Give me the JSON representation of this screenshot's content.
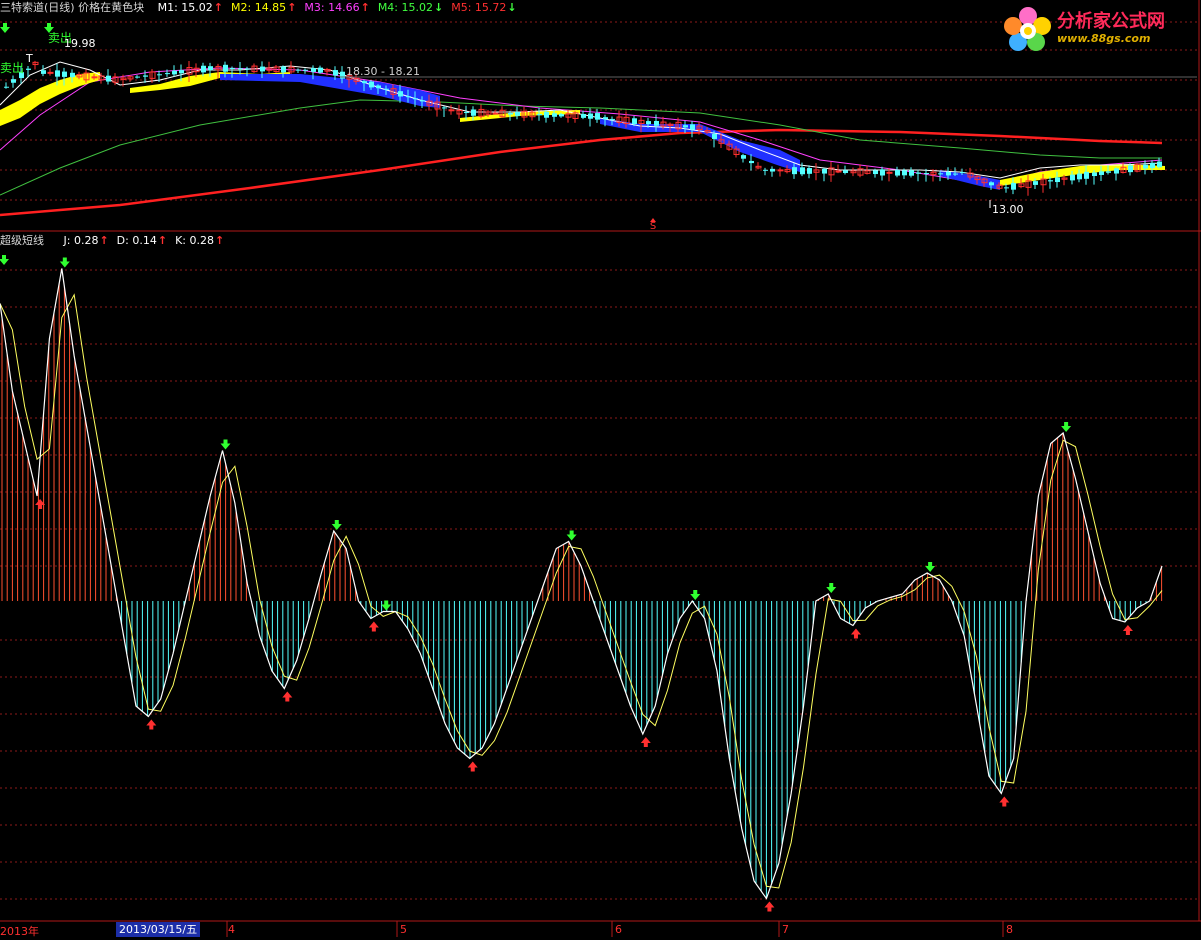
{
  "header": {
    "title": "三特索道(日线) 价格在黄色块",
    "indicators": [
      {
        "label": "M1: 15.02",
        "arrow": "↑",
        "color": "#ffffff"
      },
      {
        "label": "M2: 14.85",
        "arrow": "↑",
        "color": "#ffff00"
      },
      {
        "label": "M3: 14.66",
        "arrow": "↑",
        "color": "#ff40ff"
      },
      {
        "label": "M4: 15.02",
        "arrow": "↓",
        "color": "#40ff40"
      },
      {
        "label": "M5: 15.72",
        "arrow": "↓",
        "color": "#ff3030"
      }
    ]
  },
  "price_panel": {
    "sell_label": "卖出",
    "signal_t": "T",
    "high_label": "19.98",
    "range_label": "18.30 - 18.21",
    "low_label": "13.00",
    "marker_s": "S"
  },
  "sub_header": {
    "title": "超级短线",
    "indicators": [
      {
        "label": "J: 0.28",
        "arrow": "↑",
        "color": "#ffffff"
      },
      {
        "label": "D: 0.14",
        "arrow": "↑",
        "color": "#ffffff"
      },
      {
        "label": "K: 0.28",
        "arrow": "↑",
        "color": "#ffffff"
      }
    ]
  },
  "logo": {
    "text": "分析家公式网",
    "url": "www.88gs.com"
  },
  "date_axis": {
    "year_label": "2013年",
    "cursor_date": "2013/03/15/五",
    "months": [
      "4",
      "5",
      "6",
      "7",
      "8"
    ]
  },
  "colors": {
    "background": "#000000",
    "grid": "#8b1a1a",
    "bull_candle": "#ff3030",
    "bear_candle": "#54ffff",
    "ma_white": "#ffffff",
    "ma_yellow": "#ffff00",
    "ma_magenta": "#ff40ff",
    "ma_green": "#40c040",
    "ma_red": "#ff2020",
    "osc_positive": "#ff5030",
    "osc_negative": "#54ffff",
    "buy_arrow": "#ff3030",
    "sell_arrow": "#30ff30"
  },
  "oscillator": {
    "values": [
      0.85,
      0.6,
      0.45,
      0.3,
      0.75,
      0.95,
      0.7,
      0.5,
      0.3,
      0.1,
      -0.1,
      -0.3,
      -0.33,
      -0.28,
      -0.15,
      0.0,
      0.15,
      0.3,
      0.43,
      0.28,
      0.05,
      -0.1,
      -0.2,
      -0.25,
      -0.17,
      -0.05,
      0.08,
      0.2,
      0.15,
      0.0,
      -0.05,
      -0.03,
      -0.03,
      -0.08,
      -0.15,
      -0.25,
      -0.35,
      -0.42,
      -0.45,
      -0.42,
      -0.35,
      -0.25,
      -0.15,
      -0.05,
      0.05,
      0.15,
      0.17,
      0.1,
      0.0,
      -0.1,
      -0.2,
      -0.3,
      -0.38,
      -0.3,
      -0.15,
      -0.05,
      0.0,
      -0.05,
      -0.2,
      -0.45,
      -0.65,
      -0.8,
      -0.85,
      -0.75,
      -0.55,
      -0.3,
      0.0,
      0.02,
      -0.05,
      -0.07,
      -0.02,
      0.0,
      0.01,
      0.02,
      0.06,
      0.08,
      0.06,
      0.0,
      -0.1,
      -0.3,
      -0.5,
      -0.55,
      -0.45,
      0.0,
      0.3,
      0.45,
      0.48,
      0.35,
      0.2,
      0.05,
      -0.05,
      -0.06,
      -0.02,
      0.0,
      0.1
    ]
  }
}
